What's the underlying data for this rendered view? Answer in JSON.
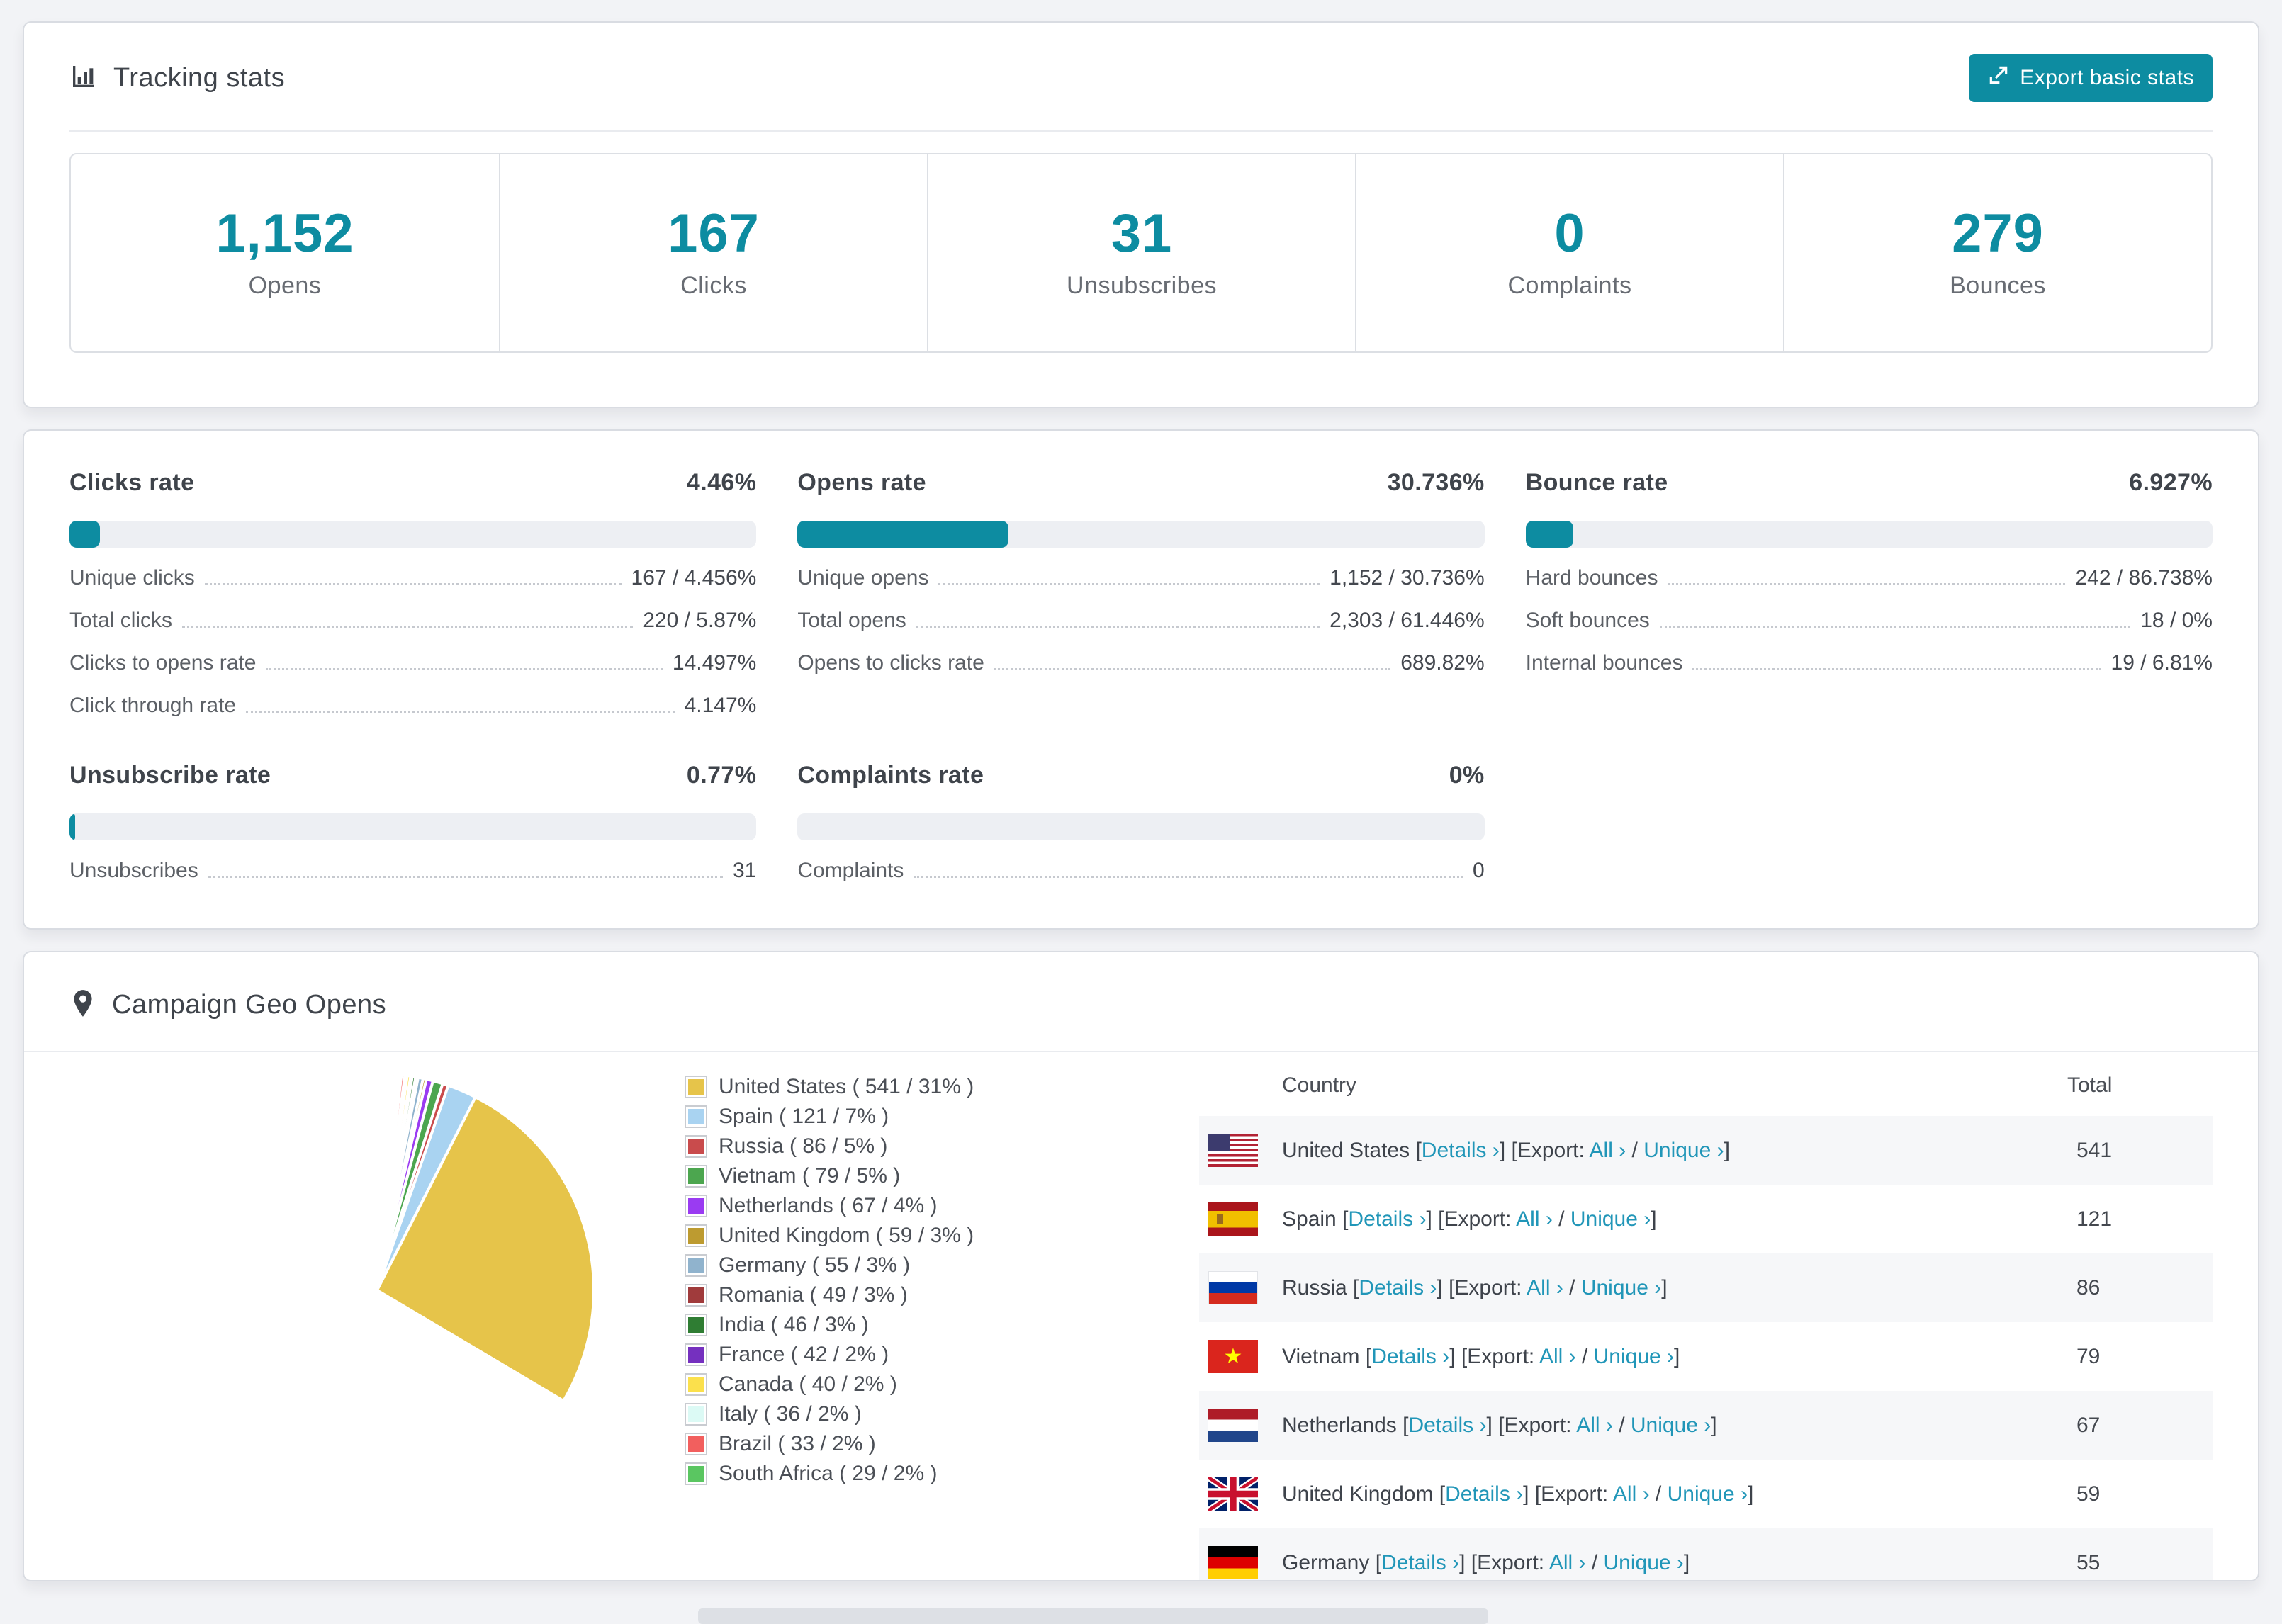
{
  "colors": {
    "accent_teal": "#0D8CA1",
    "link_teal": "#2196B8"
  },
  "header": {
    "title": "Tracking stats",
    "export_button": "Export basic stats"
  },
  "summary_stats": [
    {
      "value": "1,152",
      "label": "Opens"
    },
    {
      "value": "167",
      "label": "Clicks"
    },
    {
      "value": "31",
      "label": "Unsubscribes"
    },
    {
      "value": "0",
      "label": "Complaints"
    },
    {
      "value": "279",
      "label": "Bounces"
    }
  ],
  "rates": {
    "row1": [
      "clicks",
      "opens",
      "bounce"
    ],
    "row2": [
      "unsubscribe",
      "complaints"
    ],
    "clicks": {
      "title": "Clicks rate",
      "value": "4.46%",
      "percent": 4.46,
      "rows": [
        {
          "label": "Unique clicks",
          "value": "167 / 4.456%"
        },
        {
          "label": "Total clicks",
          "value": "220 / 5.87%"
        },
        {
          "label": "Clicks to opens rate",
          "value": "14.497%"
        },
        {
          "label": "Click through rate",
          "value": "4.147%"
        }
      ]
    },
    "opens": {
      "title": "Opens rate",
      "value": "30.736%",
      "percent": 30.736,
      "rows": [
        {
          "label": "Unique opens",
          "value": "1,152 / 30.736%"
        },
        {
          "label": "Total opens",
          "value": "2,303 / 61.446%"
        },
        {
          "label": "Opens to clicks rate",
          "value": "689.82%"
        }
      ]
    },
    "bounce": {
      "title": "Bounce rate",
      "value": "6.927%",
      "percent": 6.927,
      "rows": [
        {
          "label": "Hard bounces",
          "value": "242 / 86.738%"
        },
        {
          "label": "Soft bounces",
          "value": "18 / 0%"
        },
        {
          "label": "Internal bounces",
          "value": "19 / 6.81%"
        }
      ]
    },
    "unsubscribe": {
      "title": "Unsubscribe rate",
      "value": "0.77%",
      "percent": 0.77,
      "rows": [
        {
          "label": "Unsubscribes",
          "value": "31"
        }
      ]
    },
    "complaints": {
      "title": "Complaints rate",
      "value": "0%",
      "percent": 0,
      "rows": [
        {
          "label": "Complaints",
          "value": "0"
        }
      ]
    }
  },
  "geo": {
    "title": "Campaign Geo Opens",
    "table": {
      "columns": [
        "Country",
        "Total"
      ],
      "link_labels": {
        "details": "Details",
        "export": "Export:",
        "all": "All",
        "unique": "Unique",
        "chevron": "›"
      },
      "rows": [
        {
          "country": "United States",
          "flag": "us",
          "total": "541"
        },
        {
          "country": "Spain",
          "flag": "es",
          "total": "121"
        },
        {
          "country": "Russia",
          "flag": "ru",
          "total": "86"
        },
        {
          "country": "Vietnam",
          "flag": "vn",
          "total": "79"
        },
        {
          "country": "Netherlands",
          "flag": "nl",
          "total": "67"
        },
        {
          "country": "United Kingdom",
          "flag": "gb",
          "total": "59"
        },
        {
          "country": "Germany",
          "flag": "de",
          "total": "55",
          "partially_visible": true
        }
      ]
    }
  },
  "chart_data": {
    "type": "pie",
    "title": "Campaign Geo Opens",
    "unit": "opens",
    "legend_position": "right",
    "legend_format": "{label} ( {value} / {pct} )",
    "start_angle_deg": -90,
    "direction": "clockwise",
    "series": [
      {
        "label": "United States",
        "value": 541,
        "pct": "31%",
        "color": "#E6C44A"
      },
      {
        "label": "Spain",
        "value": 121,
        "pct": "7%",
        "color": "#A9D3F1"
      },
      {
        "label": "Russia",
        "value": 86,
        "pct": "5%",
        "color": "#C94B4C"
      },
      {
        "label": "Vietnam",
        "value": 79,
        "pct": "5%",
        "color": "#4CA64F"
      },
      {
        "label": "Netherlands",
        "value": 67,
        "pct": "4%",
        "color": "#9A3BF2"
      },
      {
        "label": "United Kingdom",
        "value": 59,
        "pct": "3%",
        "color": "#BD9B30"
      },
      {
        "label": "Germany",
        "value": 55,
        "pct": "3%",
        "color": "#90B3CD"
      },
      {
        "label": "Romania",
        "value": 49,
        "pct": "3%",
        "color": "#A03B3C"
      },
      {
        "label": "India",
        "value": 46,
        "pct": "3%",
        "color": "#2F7D33"
      },
      {
        "label": "France",
        "value": 42,
        "pct": "2%",
        "color": "#7530BF"
      },
      {
        "label": "Canada",
        "value": 40,
        "pct": "2%",
        "color": "#FBE04C"
      },
      {
        "label": "Italy",
        "value": 36,
        "pct": "2%",
        "color": "#DCFAF5"
      },
      {
        "label": "Brazil",
        "value": 33,
        "pct": "2%",
        "color": "#F25F5E"
      },
      {
        "label": "South Africa",
        "value": 29,
        "pct": "2%",
        "color": "#5AC661"
      }
    ],
    "unlabeled_tail_slices_approx": [
      26,
      24,
      22,
      20,
      18,
      17,
      16,
      15,
      14,
      13,
      12,
      11,
      10,
      9,
      9,
      8,
      8,
      7,
      7,
      6,
      6,
      5,
      5,
      5,
      4,
      4,
      4,
      3,
      3,
      3,
      3,
      2,
      2,
      2,
      2,
      2,
      1,
      1,
      1,
      1
    ]
  }
}
